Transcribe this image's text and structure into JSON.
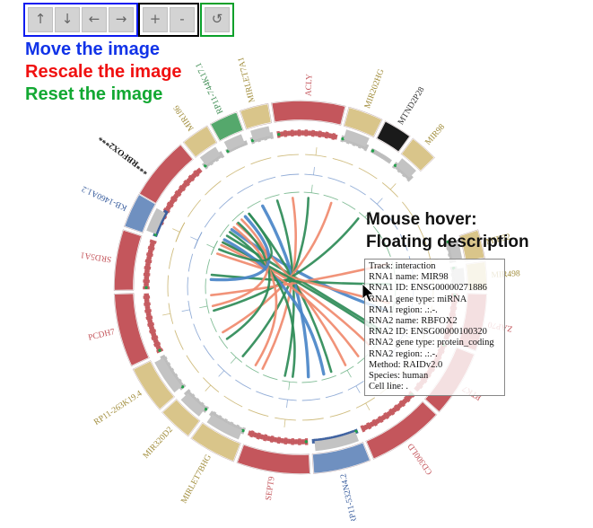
{
  "toolbar": {
    "groups": [
      {
        "name": "move",
        "color": "#0d1bf0",
        "buttons": [
          {
            "icon": "arrow-up",
            "glyph": "↑",
            "name": "move-up-button"
          },
          {
            "icon": "arrow-down",
            "glyph": "↓",
            "name": "move-down-button"
          },
          {
            "icon": "arrow-left",
            "glyph": "←",
            "name": "move-left-button"
          },
          {
            "icon": "arrow-right",
            "glyph": "→",
            "name": "move-right-button"
          }
        ]
      },
      {
        "name": "rescale",
        "color": "#f01010",
        "buttons": [
          {
            "icon": "plus",
            "glyph": "+",
            "name": "zoom-in-button"
          },
          {
            "icon": "minus",
            "glyph": "-",
            "name": "zoom-out-button"
          }
        ]
      },
      {
        "name": "reset",
        "color": "#0aa02a",
        "buttons": [
          {
            "icon": "refresh",
            "glyph": "↺",
            "name": "reset-button"
          }
        ]
      }
    ]
  },
  "legend": {
    "move": "Move the image",
    "rescale": "Rescale the image",
    "reset": "Reset the image"
  },
  "annotation": {
    "hover_note": "Mouse hover:\nFloating description"
  },
  "tooltip": {
    "rows": [
      "Track: interaction",
      "RNA1 name: MIR98",
      "RNA1 ID: ENSG00000271886",
      "RNA1 gene type: miRNA",
      "RNA1 region: .:.-.",
      "RNA2 name: RBFOX2",
      "RNA2 ID: ENSG00000100320",
      "RNA2 gene type: protein_coding",
      "RNA2 region: .:.-.",
      "Method: RAIDv2.0",
      "Species: human",
      "Cell line: ."
    ]
  },
  "circos": {
    "colors": {
      "protein_coding": "#c4565c",
      "mirna": "#d9c58a",
      "lincrna": "#6f90c0",
      "antisense": "#55a86c",
      "mt": "#1a1a1a",
      "grey": "#c3c3c3",
      "track_tan": "#c8b26a",
      "track_blue": "#7f9fd0",
      "track_green": "#6bb184",
      "link_orange": "#f08a6e",
      "link_green": "#2e8b57",
      "link_blue": "#4a86c8"
    },
    "genes": [
      {
        "label": "***RBFOX2***",
        "color": "#c4565c",
        "type": "protein_coding",
        "a0": -66,
        "a1": -40,
        "lcolor": "#111111",
        "bold": true
      },
      {
        "label": "MIR186",
        "color": "#d9c58a",
        "type": "mirna",
        "a0": -39,
        "a1": -30,
        "lcolor": "#a08c3a"
      },
      {
        "label": "RP11-744K17.1",
        "color": "#55a86c",
        "type": "antisense",
        "a0": -29,
        "a1": -20,
        "lcolor": "#3d8c52"
      },
      {
        "label": "MIRLET7A1",
        "color": "#d9c58a",
        "type": "mirna",
        "a0": -19,
        "a1": -10,
        "lcolor": "#a08c3a"
      },
      {
        "label": "ACLY",
        "color": "#c4565c",
        "type": "protein_coding",
        "a0": -9,
        "a1": 14,
        "lcolor": "#c4565c"
      },
      {
        "label": "MIR202HG",
        "color": "#d9c58a",
        "type": "mirna",
        "a0": 15,
        "a1": 26,
        "lcolor": "#a08c3a"
      },
      {
        "label": "MTND2P28",
        "color": "#1a1a1a",
        "type": "mt",
        "a0": 27,
        "a1": 36,
        "lcolor": "#333333"
      },
      {
        "label": "MIR98",
        "color": "#d9c58a",
        "type": "mirna",
        "a0": 37,
        "a1": 46,
        "lcolor": "#a08c3a"
      },
      {
        "label": "MIR32",
        "color": "#d9c58a",
        "type": "mirna",
        "a0": 72,
        "a1": 81,
        "lcolor": "#a08c3a"
      },
      {
        "label": "MIR498",
        "color": "#d9c58a",
        "type": "mirna",
        "a0": 82,
        "a1": 91,
        "lcolor": "#a08c3a"
      },
      {
        "label": "ZAP70",
        "color": "#c4565c",
        "type": "protein_coding",
        "a0": 92,
        "a1": 110,
        "lcolor": "#c4565c"
      },
      {
        "label": "PTK7",
        "color": "#c4565c",
        "type": "protein_coding",
        "a0": 111,
        "a1": 132,
        "lcolor": "#c4565c"
      },
      {
        "label": "CD300LD",
        "color": "#c4565c",
        "type": "protein_coding",
        "a0": 133,
        "a1": 157,
        "lcolor": "#c4565c"
      },
      {
        "label": "RP11-532N4.2",
        "color": "#6f90c0",
        "type": "lincrna",
        "a0": 158,
        "a1": 176,
        "lcolor": "#3a5e9e"
      },
      {
        "label": "SEPT9",
        "color": "#c4565c",
        "type": "protein_coding",
        "a0": 177,
        "a1": 200,
        "lcolor": "#c4565c"
      },
      {
        "label": "MIRLET7BHG",
        "color": "#d9c58a",
        "type": "mirna",
        "a0": 201,
        "a1": 216,
        "lcolor": "#a08c3a"
      },
      {
        "label": "MIR320D2",
        "color": "#d9c58a",
        "type": "mirna",
        "a0": 217,
        "a1": 228,
        "lcolor": "#a08c3a"
      },
      {
        "label": "RP11-263K19.4",
        "color": "#d9c58a",
        "type": "mirna",
        "a0": 229,
        "a1": 244,
        "lcolor": "#a08c3a"
      },
      {
        "label": "PCDH7",
        "color": "#c4565c",
        "type": "protein_coding",
        "a0": 245,
        "a1": 268,
        "lcolor": "#c4565c"
      },
      {
        "label": "SRD5A1",
        "color": "#c4565c",
        "type": "protein_coding",
        "a0": 269,
        "a1": 288,
        "lcolor": "#c4565c"
      },
      {
        "label": "KB-1460A1.2",
        "color": "#6f90c0",
        "type": "lincrna",
        "a0": 289,
        "a1": 300,
        "lcolor": "#3a5e9e"
      }
    ],
    "links": [
      {
        "a": -60,
        "b": 130,
        "color": "#f08a6e"
      },
      {
        "a": -55,
        "b": 118,
        "color": "#2e8b57"
      },
      {
        "a": -50,
        "b": 105,
        "color": "#4a86c8"
      },
      {
        "a": -45,
        "b": 150,
        "color": "#f08a6e"
      },
      {
        "a": -35,
        "b": 160,
        "color": "#2e8b57"
      },
      {
        "a": -25,
        "b": 175,
        "color": "#4a86c8"
      },
      {
        "a": -15,
        "b": 190,
        "color": "#2e8b57"
      },
      {
        "a": -5,
        "b": 205,
        "color": "#f08a6e"
      },
      {
        "a": 5,
        "b": 220,
        "color": "#2e8b57"
      },
      {
        "a": 20,
        "b": 240,
        "color": "#f08a6e"
      },
      {
        "a": 40,
        "b": 255,
        "color": "#2e8b57"
      },
      {
        "a": 75,
        "b": 265,
        "color": "#f08a6e"
      },
      {
        "a": 88,
        "b": 278,
        "color": "#2e8b57"
      },
      {
        "a": 100,
        "b": 292,
        "color": "#f08a6e"
      },
      {
        "a": 120,
        "b": 300,
        "color": "#2e8b57"
      },
      {
        "a": 140,
        "b": -62,
        "color": "#f08a6e"
      },
      {
        "a": 165,
        "b": -58,
        "color": "#4a86c8"
      },
      {
        "a": 185,
        "b": -52,
        "color": "#2e8b57"
      },
      {
        "a": 210,
        "b": -48,
        "color": "#f08a6e"
      },
      {
        "a": 235,
        "b": -44,
        "color": "#2e8b57"
      },
      {
        "a": 258,
        "b": -41,
        "color": "#f08a6e"
      },
      {
        "a": 275,
        "b": -38,
        "color": "#4a86c8"
      },
      {
        "a": 295,
        "b": -35,
        "color": "#2e8b57"
      }
    ],
    "inner_tracks": [
      {
        "name": "track-tan",
        "color": "#c8b26a",
        "radius": 148
      },
      {
        "name": "track-blue",
        "color": "#7f9fd0",
        "radius": 126
      },
      {
        "name": "track-green",
        "color": "#6bb184",
        "radius": 106
      }
    ]
  }
}
